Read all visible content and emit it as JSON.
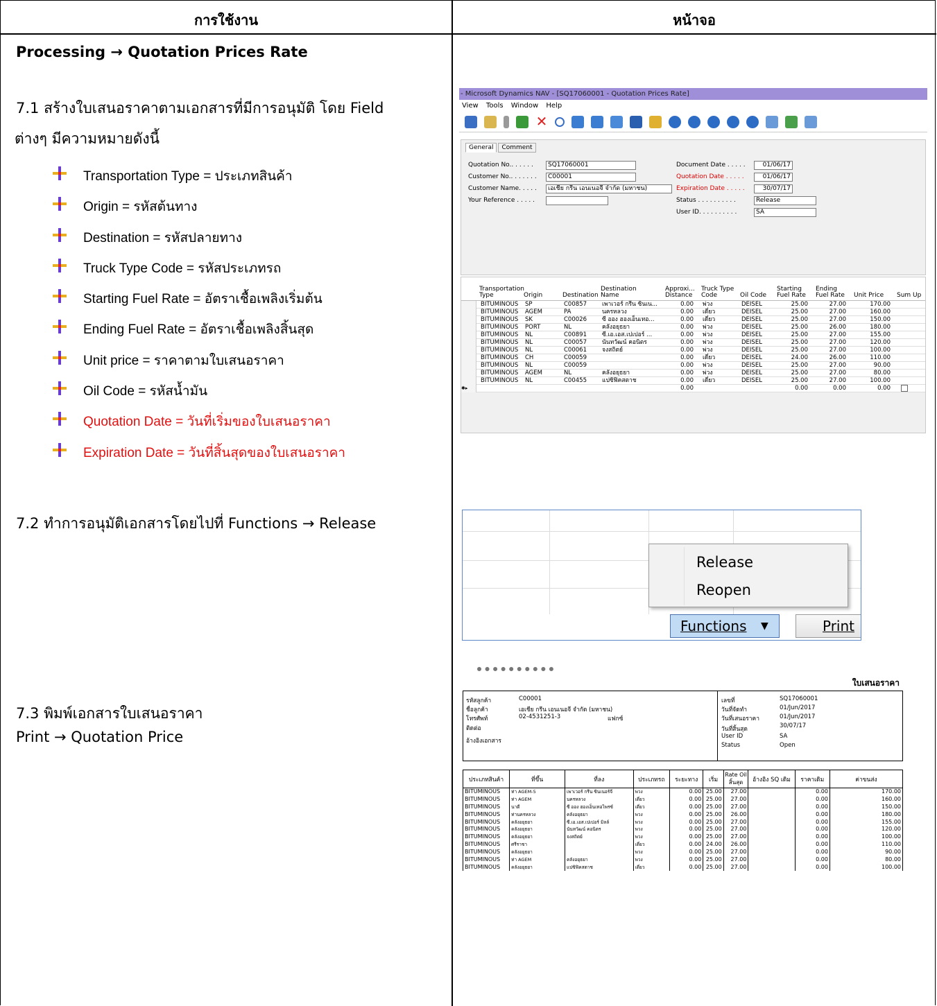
{
  "headers": {
    "col1": "การใช้งาน",
    "col2": "หน้าจอ"
  },
  "section_title": "Processing → Quotation Prices Rate",
  "step71": {
    "line1": "7.1  สร้างใบเสนอราคาตามเอกสารที่มีการอนุมัติ โดย Field",
    "line2": "ต่างๆ มีความหมายดังนี้"
  },
  "bullets": [
    {
      "text": "Transportation Type = ประเภทสินค้า",
      "color": "#000000"
    },
    {
      "text": "Origin = รหัสต้นทาง",
      "color": "#000000"
    },
    {
      "text": "Destination = รหัสปลายทาง",
      "color": "#000000"
    },
    {
      "text": "Truck Type Code  = รหัสประเภทรถ",
      "color": "#000000"
    },
    {
      "text": "Starting Fuel Rate = อัตราเชื้อเพลิงเริ่มต้น",
      "color": "#000000"
    },
    {
      "text": "Ending Fuel Rate = อัตราเชื้อเพลิงสิ้นสุด",
      "color": "#000000"
    },
    {
      "text": "Unit price = ราคาตามใบเสนอราคา",
      "color": "#000000"
    },
    {
      "text": "Oil Code  = รหัสน้ำมัน",
      "color": "#000000"
    },
    {
      "text": "Quotation Date = วันที่เริ่มของใบเสนอราคา",
      "color": "#e11111"
    },
    {
      "text": "Expiration Date = วันที่สิ้นสุดของใบเสนอราคา",
      "color": "#e11111"
    }
  ],
  "step72": "7.2  ทำการอนุมัติเอกสารโดยไปที่ Functions → Release",
  "step73": {
    "line1": "7.3 พิมพ์เอกสารใบเสนอราคา",
    "line2": "Print → Quotation Price"
  },
  "nav": {
    "title": "- Microsoft Dynamics NAV - [SQ17060001 - Quotation Prices Rate]",
    "menu": [
      "View",
      "Tools",
      "Window",
      "Help"
    ],
    "tabs": [
      "General",
      "Comment"
    ],
    "fields_left": [
      {
        "label": "Quotation No.. . . . . .",
        "value": "SQ17060001"
      },
      {
        "label": "Customer No.. . . . . . .",
        "value": "C00001"
      },
      {
        "label": "Customer Name. . . . .",
        "value": "เอเชีย กรีน เอนเนอจี จำกัด (มหาชน)"
      },
      {
        "label": "Your Reference . . . . .",
        "value": ""
      }
    ],
    "fields_right": [
      {
        "label": "Document Date . . . . .",
        "value": "01/06/17"
      },
      {
        "label": "Quotation Date . . . . .",
        "value": "01/06/17"
      },
      {
        "label": "Expiration Date . . . . .",
        "value": "30/07/17"
      },
      {
        "label": "Status  . . . . . . . . . .",
        "value": "Release"
      },
      {
        "label": "User ID. . . . . . . . . .",
        "value": "SA"
      }
    ],
    "columns": [
      "Transportation Type",
      "Origin",
      "Destination",
      "Destination Name",
      "Approxi... Distance",
      "Truck Type Code",
      "Oil Code",
      "Starting Fuel Rate",
      "Ending Fuel Rate",
      "Unit Price",
      "Sum Up"
    ],
    "rows": [
      [
        "BITUMINOUS",
        "SP",
        "C00857",
        "เพาเวอร์ กรีน ซินเน...",
        "0.00",
        "พ่วง",
        "DEISEL",
        "25.00",
        "27.00",
        "170.00"
      ],
      [
        "BITUMINOUS",
        "AGEM",
        "PA",
        "นครหลวง",
        "0.00",
        "เดี่ยว",
        "DEISEL",
        "25.00",
        "27.00",
        "160.00"
      ],
      [
        "BITUMINOUS",
        "SK",
        "C00026",
        "ซี ออง ฮองเอ็นเทอ...",
        "0.00",
        "เดี่ยว",
        "DEISEL",
        "25.00",
        "27.00",
        "150.00"
      ],
      [
        "BITUMINOUS",
        "PORT",
        "NL",
        "คลังอยุธยา",
        "0.00",
        "พ่วง",
        "DEISEL",
        "25.00",
        "26.00",
        "180.00"
      ],
      [
        "BITUMINOUS",
        "NL",
        "C00891",
        "ซี.เอ.เอส.เปเปอร์ ...",
        "0.00",
        "พ่วง",
        "DEISEL",
        "25.00",
        "27.00",
        "155.00"
      ],
      [
        "BITUMINOUS",
        "NL",
        "C00057",
        "นันทวัฒน์ คอนิตร",
        "0.00",
        "พ่วง",
        "DEISEL",
        "25.00",
        "27.00",
        "120.00"
      ],
      [
        "BITUMINOUS",
        "NL",
        "C00061",
        "จงสถิตย์",
        "0.00",
        "พ่วง",
        "DEISEL",
        "25.00",
        "27.00",
        "100.00"
      ],
      [
        "BITUMINOUS",
        "CH",
        "C00059",
        "",
        "0.00",
        "เดี่ยว",
        "DEISEL",
        "24.00",
        "26.00",
        "110.00"
      ],
      [
        "BITUMINOUS",
        "NL",
        "C00059",
        "",
        "0.00",
        "พ่วง",
        "DEISEL",
        "25.00",
        "27.00",
        "90.00"
      ],
      [
        "BITUMINOUS",
        "AGEM",
        "NL",
        "คลังอยุธยา",
        "0.00",
        "พ่วง",
        "DEISEL",
        "25.00",
        "27.00",
        "80.00"
      ],
      [
        "BITUMINOUS",
        "NL",
        "C00455",
        "แปซิฟิคสตาช",
        "0.00",
        "เดี่ยว",
        "DEISEL",
        "25.00",
        "27.00",
        "100.00"
      ],
      [
        "",
        "",
        "",
        "",
        "0.00",
        "",
        "",
        "0.00",
        "0.00",
        "0.00"
      ]
    ]
  },
  "functions_menu": {
    "items": [
      "Release",
      "Reopen"
    ],
    "functions_button": "Functions",
    "print_button": "Print"
  },
  "quotation": {
    "title": "ใบเสนอราคา",
    "left_labels": [
      "รหัสลูกค้า",
      "ชื่อลูกค้า",
      "โทรศัพท์",
      "ติดต่อ",
      "อ้างอิงเอกสาร"
    ],
    "customer_code": "C00001",
    "customer_name": "เอเชีย กรีน เอนเนอจี จำกัด (มหาชน)",
    "phone": "02-4531251-3",
    "fax_label": "แฟกซ์",
    "right_labels": [
      "เลขที่",
      "วันที่จัดทำ",
      "วันที่เสนอราคา",
      "วันที่สิ้นสุด",
      "User ID",
      "Status"
    ],
    "right_values": [
      "SQ17060001",
      "01/Jun/2017",
      "01/Jun/2017",
      "30/07/17",
      "SA",
      "Open"
    ],
    "columns": [
      "ประเภทสินค้า",
      "ที่ขึ้น",
      "ที่ลง",
      "ประเภทรถ",
      "ระยะทาง",
      "เริ่ม",
      "Rate Oil สิ้นสุด",
      "อ้างอิง SQ เดิม",
      "ราคาเดิม",
      "ค่าขนส่ง"
    ],
    "rate_oil_label": "Rate Oil",
    "rows": [
      [
        "BITUMINOUS",
        "ท่า AGEM-5",
        "เพาเวอร์ กรีน ซินเนอร์จี",
        "พวง",
        "0.00",
        "25.00",
        "27.00",
        "",
        "0.00",
        "170.00"
      ],
      [
        "BITUMINOUS",
        "ท่า AGEM",
        "นครหลวง",
        "เดี่ยว",
        "0.00",
        "25.00",
        "27.00",
        "",
        "0.00",
        "160.00"
      ],
      [
        "BITUMINOUS",
        "นาดี",
        "ซี ออง ฮองเอ็นเทอไพรซ์",
        "เดี่ยว",
        "0.00",
        "25.00",
        "27.00",
        "",
        "0.00",
        "150.00"
      ],
      [
        "BITUMINOUS",
        "ท่านครหลวง",
        "คลังอยุธยา",
        "พวง",
        "0.00",
        "25.00",
        "26.00",
        "",
        "0.00",
        "180.00"
      ],
      [
        "BITUMINOUS",
        "คลังอยุธยา",
        "ซี.เอ.เอส.เปเปอร์ มิลล์",
        "พวง",
        "0.00",
        "25.00",
        "27.00",
        "",
        "0.00",
        "155.00"
      ],
      [
        "BITUMINOUS",
        "คลังอยุธยา",
        "นันทวัฒน์ คอนิตร",
        "พวง",
        "0.00",
        "25.00",
        "27.00",
        "",
        "0.00",
        "120.00"
      ],
      [
        "BITUMINOUS",
        "คลังอยุธยา",
        "จงสถิตย์",
        "พวง",
        "0.00",
        "25.00",
        "27.00",
        "",
        "0.00",
        "100.00"
      ],
      [
        "BITUMINOUS",
        "ศรีราชา",
        "",
        "เดี่ยว",
        "0.00",
        "24.00",
        "26.00",
        "",
        "0.00",
        "110.00"
      ],
      [
        "BITUMINOUS",
        "คลังอยุธยา",
        "",
        "พวง",
        "0.00",
        "25.00",
        "27.00",
        "",
        "0.00",
        "90.00"
      ],
      [
        "BITUMINOUS",
        "ท่า AGEM",
        "คลังอยุธยา",
        "พวง",
        "0.00",
        "25.00",
        "27.00",
        "",
        "0.00",
        "80.00"
      ],
      [
        "BITUMINOUS",
        "คลังอยุธยา",
        "แปซิฟิคสตาช",
        "เดี่ยว",
        "0.00",
        "25.00",
        "27.00",
        "",
        "0.00",
        "100.00"
      ]
    ]
  }
}
